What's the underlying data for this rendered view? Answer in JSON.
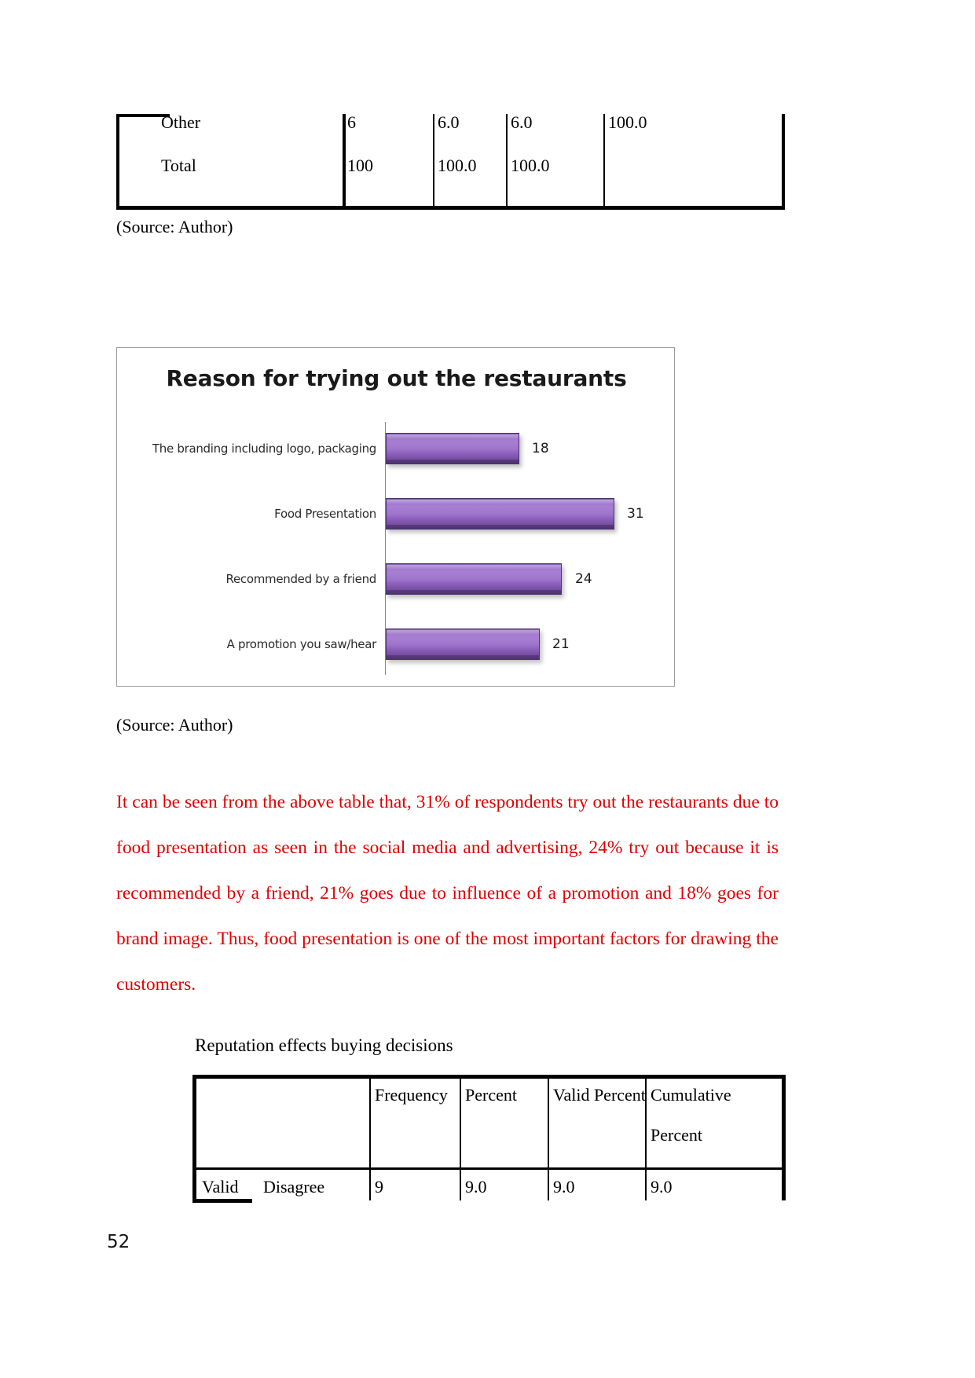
{
  "document": {
    "page_number": "52",
    "source_note_1": "(Source: Author)",
    "source_note_2": "(Source: Author)"
  },
  "top_table": {
    "rows": [
      {
        "label": "Other",
        "frequency": "6",
        "percent": "6.0",
        "valid_percent": "6.0",
        "cumulative_percent": "100.0"
      },
      {
        "label": "Total",
        "frequency": "100",
        "percent": "100.0",
        "valid_percent": "100.0",
        "cumulative_percent": ""
      }
    ]
  },
  "chart_data": {
    "type": "bar",
    "orientation": "horizontal",
    "title": "Reason for trying out the restaurants",
    "categories": [
      "The branding including logo, packaging",
      "Food Presentation",
      "Recommended by a friend",
      "A promotion you saw/hear"
    ],
    "values": [
      18,
      31,
      24,
      21
    ],
    "labels": [
      "18",
      "31",
      "24",
      "21"
    ],
    "xlabel": "",
    "ylabel": "",
    "xlim": [
      0,
      35
    ],
    "grid": false,
    "legend": false,
    "series": [
      {
        "name": "Reason for trying out the restaurants",
        "values": [
          18,
          31,
          24,
          21
        ]
      }
    ],
    "colors": {
      "bar_light": "#a77fd2",
      "bar_mid": "#8559b4",
      "bar_dark": "#5f3f85",
      "bar_border": "#4c3270",
      "axis": "#868686",
      "frame": "#9a9a9a",
      "title": "#1a1a1a"
    }
  },
  "commentary": {
    "color": "#e00000",
    "text": "It can be seen from the above table that, 31% of respondents try out the restaurants due to food presentation as seen in the social media and advertising, 24% try out because it is recommended by a friend, 21% goes due to influence of a promotion and 18% goes for brand image. Thus, food presentation is one of the most important factors for drawing the customers."
  },
  "lower_section": {
    "subheading": "Reputation effects buying decisions",
    "table": {
      "columns": [
        "",
        "Frequency",
        "Percent",
        "Valid Percent",
        "Cumulative Percent"
      ],
      "header_cumulative_line1": "Cumulative",
      "header_cumulative_line2": "Percent",
      "rows": [
        {
          "group": "Valid",
          "label": "Disagree",
          "frequency": "9",
          "percent": "9.0",
          "valid_percent": "9.0",
          "cumulative_percent": "9.0"
        }
      ]
    }
  }
}
